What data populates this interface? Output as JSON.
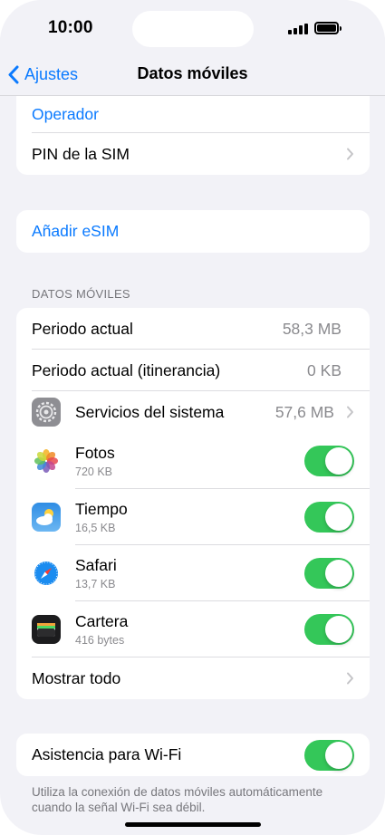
{
  "status_bar": {
    "time": "10:00"
  },
  "nav": {
    "back_label": "Ajustes",
    "title": "Datos móviles"
  },
  "group1": {
    "operator_label": "Operador",
    "sim_pin_label": "PIN de la SIM"
  },
  "group2": {
    "add_esim_label": "Añadir eSIM"
  },
  "section_header": "DATOS MÓVILES",
  "usage": {
    "current_period_label": "Periodo actual",
    "current_period_value": "58,3 MB",
    "roaming_label": "Periodo actual (itinerancia)",
    "roaming_value": "0 KB",
    "system_services_label": "Servicios del sistema",
    "system_services_value": "57,6 MB"
  },
  "apps": [
    {
      "name": "Fotos",
      "usage": "720 KB",
      "enabled": true,
      "icon": "photos-icon"
    },
    {
      "name": "Tiempo",
      "usage": "16,5 KB",
      "enabled": true,
      "icon": "weather-icon"
    },
    {
      "name": "Safari",
      "usage": "13,7 KB",
      "enabled": true,
      "icon": "safari-icon"
    },
    {
      "name": "Cartera",
      "usage": "416 bytes",
      "enabled": true,
      "icon": "wallet-icon"
    }
  ],
  "show_all_label": "Mostrar todo",
  "wifi_assist": {
    "label": "Asistencia para Wi-Fi",
    "enabled": true,
    "footer": "Utiliza la conexión de datos móviles automáticamente cuando la señal Wi-Fi sea débil."
  },
  "colors": {
    "accent": "#0a7aff",
    "toggle_on": "#34c759",
    "background": "#f2f2f7"
  }
}
